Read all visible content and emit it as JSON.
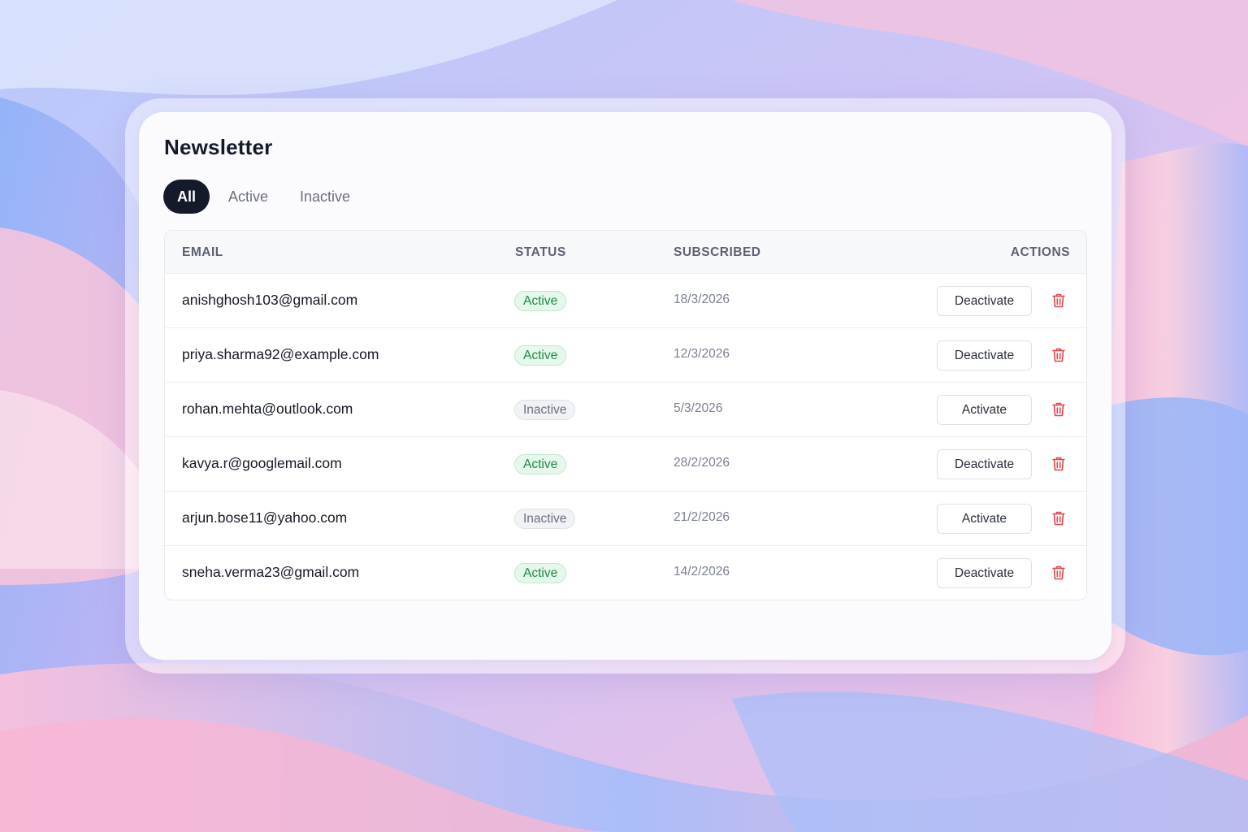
{
  "page": {
    "title": "Newsletter"
  },
  "tabs": [
    {
      "label": "All",
      "selected": true
    },
    {
      "label": "Active",
      "selected": false
    },
    {
      "label": "Inactive",
      "selected": false
    }
  ],
  "table": {
    "headers": {
      "email": "EMAIL",
      "status": "STATUS",
      "subscribed": "SUBSCRIBED",
      "actions": "ACTIONS"
    },
    "rows": [
      {
        "email": "anishghosh103@gmail.com",
        "status": "Active",
        "subscribed": "18/3/2026",
        "action": "Deactivate",
        "delete_icon": "trash-icon"
      },
      {
        "email": "priya.sharma92@example.com",
        "status": "Active",
        "subscribed": "12/3/2026",
        "action": "Deactivate",
        "delete_icon": "trash-icon"
      },
      {
        "email": "rohan.mehta@outlook.com",
        "status": "Inactive",
        "subscribed": "5/3/2026",
        "action": "Activate",
        "delete_icon": "trash-icon"
      },
      {
        "email": "kavya.r@googlemail.com",
        "status": "Active",
        "subscribed": "28/2/2026",
        "action": "Deactivate",
        "delete_icon": "trash-icon"
      },
      {
        "email": "arjun.bose11@yahoo.com",
        "status": "Inactive",
        "subscribed": "21/2/2026",
        "action": "Activate",
        "delete_icon": "trash-icon"
      },
      {
        "email": "sneha.verma23@gmail.com",
        "status": "Active",
        "subscribed": "14/2/2026",
        "action": "Deactivate",
        "delete_icon": "trash-icon"
      }
    ]
  },
  "colors": {
    "primary_dark": "#151a2b",
    "active_badge_text": "#1f8a47",
    "active_badge_bg": "#e6f7ec",
    "inactive_badge_text": "#6b7080",
    "delete_icon": "#e0474c"
  }
}
